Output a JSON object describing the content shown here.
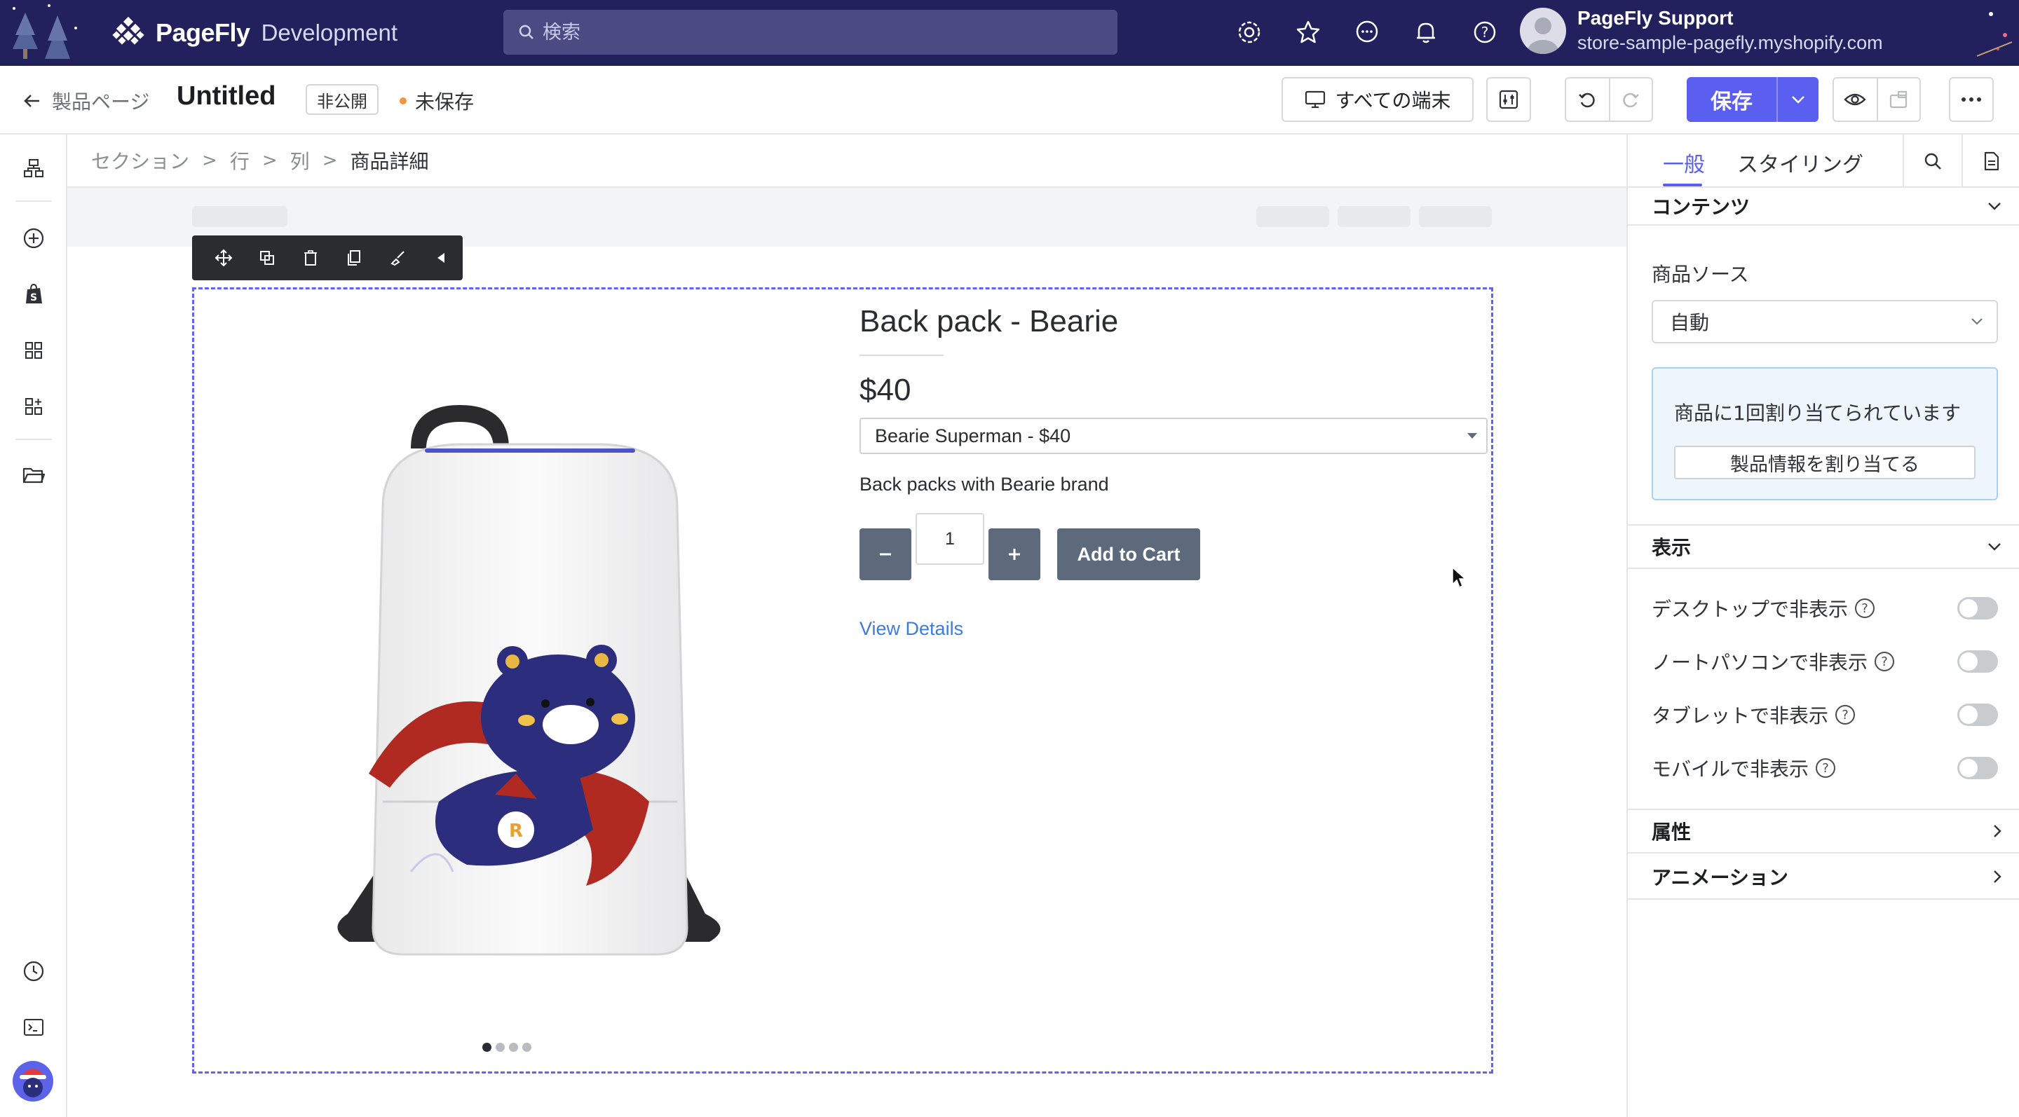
{
  "topbar": {
    "brand_name": "PageFly",
    "brand_env": "Development",
    "search_placeholder": "検索",
    "icons": [
      "settings-icon",
      "star-icon",
      "chat-icon",
      "bell-icon",
      "help-icon"
    ],
    "account_name": "PageFly Support",
    "account_store": "store-sample-pagefly.myshopify.com",
    "bg_color": "#22215e"
  },
  "toolbar": {
    "back_label": "製品ページ",
    "title": "Untitled",
    "visibility": "非公開",
    "save_status": "未保存",
    "device_label": "すべての端末",
    "save_label": "保存",
    "accent_color": "#5a5ff0"
  },
  "breadcrumb": {
    "items": [
      "セクション",
      "行",
      "列",
      "商品詳細"
    ]
  },
  "product": {
    "title": "Back pack - Bearie",
    "price": "$40",
    "variant": "Bearie Superman - $40",
    "description": "Back packs with Bearie brand",
    "quantity": "1",
    "add_to_cart": "Add to Cart",
    "view_details": "View Details",
    "gallery_count": 4,
    "gallery_active": 1
  },
  "panel": {
    "tab_general": "一般",
    "tab_styling": "スタイリング",
    "content_section": "コンテンツ",
    "product_source_label": "商品ソース",
    "product_source_value": "自動",
    "info_text": "商品に1回割り当てられています",
    "assign_button": "製品情報を割り当てる",
    "display_section": "表示",
    "toggles": [
      {
        "label": "デスクトップで非表示",
        "on": false
      },
      {
        "label": "ノートパソコンで非表示",
        "on": false
      },
      {
        "label": "タブレットで非表示",
        "on": false
      },
      {
        "label": "モバイルで非表示",
        "on": false
      }
    ],
    "attributes_section": "属性",
    "animation_section": "アニメーション"
  }
}
